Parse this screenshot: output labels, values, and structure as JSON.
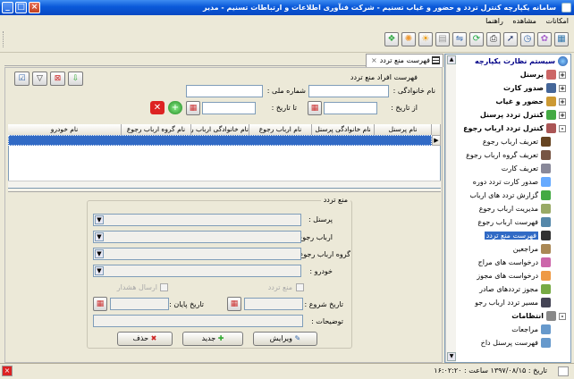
{
  "window": {
    "title": "سامانه یکپارچه کنترل تردد و حضور و غیاب تسنیم - شرکت فنآوری اطلاعات و ارتباطات تسنیم - مدیر"
  },
  "menu": [
    "امکانات",
    "مشاهده",
    "راهنما"
  ],
  "tree": {
    "root": "سیستم نظارت یکپارچه",
    "items": [
      {
        "label": "پرسنل",
        "bold": true,
        "expander": "+",
        "color": "#c66"
      },
      {
        "label": "صدور کارت",
        "bold": true,
        "expander": "+",
        "color": "#469"
      },
      {
        "label": "حضور و غیاب",
        "bold": true,
        "expander": "+",
        "color": "#c93"
      },
      {
        "label": "کنترل تردد پرسنل",
        "bold": true,
        "expander": "+",
        "color": "#4a4"
      },
      {
        "label": "کنترل تردد ارباب رجوع",
        "bold": true,
        "expander": "-",
        "color": "#a55"
      },
      {
        "label": "تعریف ارباب رجوع",
        "child": true,
        "color": "#642"
      },
      {
        "label": "تعریف گروه ارباب رجوع",
        "child": true,
        "color": "#754"
      },
      {
        "label": "تعریف کارت",
        "child": true,
        "color": "#889"
      },
      {
        "label": "صدور کارت تردد دوره",
        "child": true,
        "color": "#6af"
      },
      {
        "label": "گزارش تردد های ارباب",
        "child": true,
        "color": "#4a4"
      },
      {
        "label": "مدیریت ارباب رجوع",
        "child": true,
        "color": "#9a6"
      },
      {
        "label": "فهرست ارباب رجوع",
        "child": true,
        "color": "#58a"
      },
      {
        "label": "فهرست منع تردد",
        "child": true,
        "selected": true,
        "color": "#333"
      },
      {
        "label": "مراجعین",
        "child": true,
        "color": "#a85"
      },
      {
        "label": "درخواست های مراج",
        "child": true,
        "color": "#c6a"
      },
      {
        "label": "درخواست های مجوز",
        "child": true,
        "color": "#e94"
      },
      {
        "label": "مجوز ترددهای صادر",
        "child": true,
        "color": "#7a4"
      },
      {
        "label": "مسیر تردد ارباب رجو",
        "child": true,
        "color": "#445"
      },
      {
        "label": "انتظامات",
        "bold": true,
        "expander": "-",
        "color": "#888"
      },
      {
        "label": "مراجعات",
        "child": true,
        "color": "#69c"
      },
      {
        "label": "فهرست پرسنل داخ",
        "child": true,
        "color": "#69c"
      }
    ]
  },
  "tab": {
    "title": "فهرست منع تردد"
  },
  "search": {
    "group_title": "فهرست افراد منع تردد",
    "last_name_label": "نام خانوادگی :",
    "national_id_label": "شماره ملی :",
    "from_date_label": "از تاریخ :",
    "to_date_label": "تا تاریخ :"
  },
  "grid": {
    "columns": [
      "نام پرسنل",
      "نام خانوادگی پرسنل",
      "نام ارباب رجوع",
      "نام خانوادگی ارباب رجوع",
      "نام گروه ارباب رجوع",
      "نام خودرو"
    ]
  },
  "detail": {
    "group_title": "منع تردد",
    "personnel_label": "پرسنل :",
    "client_label": "ارباب رجوع :",
    "client_group_label": "گروه ارباب رجوع :",
    "vehicle_label": "خودرو :",
    "ban_checkbox_label": "منع تردد",
    "alert_checkbox_label": "ارسال هشدار",
    "start_date_label": "تاریخ شروع :",
    "end_date_label": "تاریخ پایان :",
    "description_label": "توضیحات :",
    "edit_button": "ویرایش",
    "new_button": "جدید",
    "delete_button": "حذف"
  },
  "status": {
    "text": "تاریخ : ۱۳۹۷/۰۸/۱۵ ساعت : ۱۶:۰۲:۲۰"
  }
}
